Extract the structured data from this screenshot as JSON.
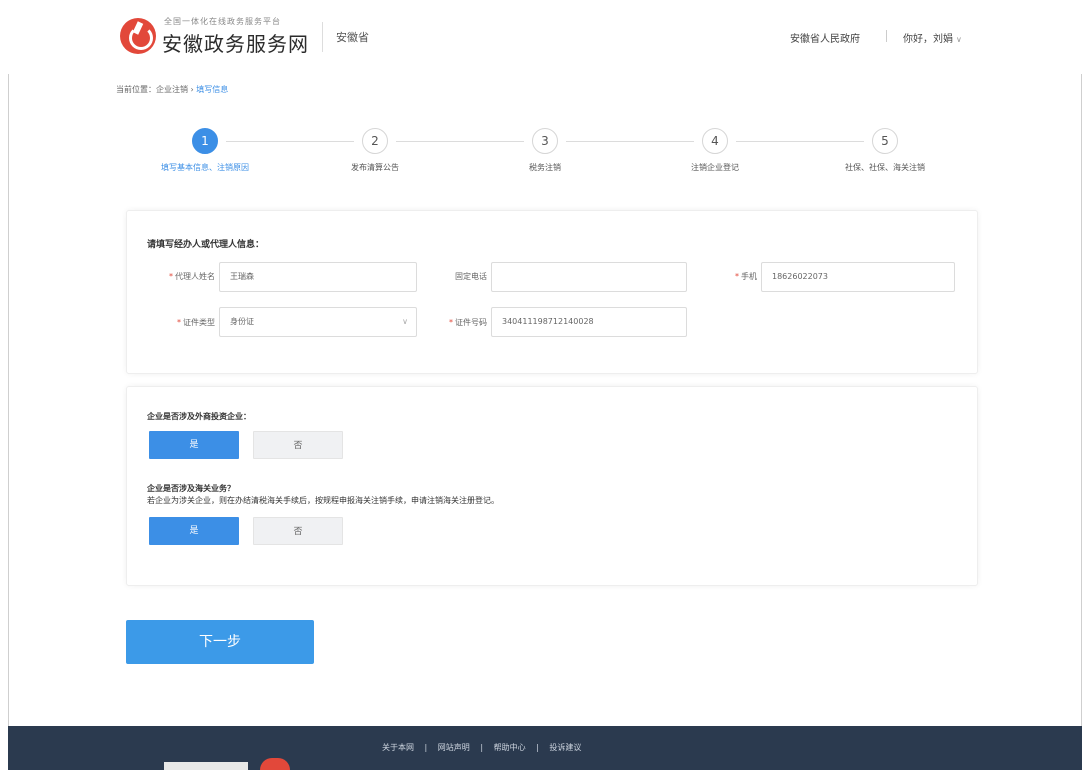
{
  "header": {
    "logo_subtitle": "全国一体化在线政务服务平台",
    "logo_title": "安徽政务服务网",
    "region": "安徽省",
    "gov_link": "安徽省人民政府",
    "user_greeting": "你好，刘娟",
    "chevron_icon": "chevron-down-icon"
  },
  "breadcrumb": {
    "prefix": "当前位置：企业注销 › ",
    "current": "填写信息"
  },
  "stepper": {
    "active_index": 1,
    "steps": [
      {
        "num": "1",
        "label": "填写基本信息、注销原因"
      },
      {
        "num": "2",
        "label": "发布清算公告"
      },
      {
        "num": "3",
        "label": "税务注销"
      },
      {
        "num": "4",
        "label": "注销企业登记"
      },
      {
        "num": "5",
        "label": "社保、社保、海关注销"
      }
    ]
  },
  "agent_form": {
    "title": "请填写经办人或代理人信息：",
    "fields": {
      "name": {
        "label": "代理人姓名",
        "required": true,
        "value": "王瑞森"
      },
      "landline": {
        "label": "固定电话",
        "required": false,
        "value": ""
      },
      "mobile": {
        "label": "手机",
        "required": true,
        "value": "18626022073"
      },
      "id_type": {
        "label": "证件类型",
        "required": true,
        "value": "身份证"
      },
      "id_number": {
        "label": "证件号码",
        "required": true,
        "value": "340411198712140028"
      }
    }
  },
  "questions": {
    "q1": {
      "title": "企业是否涉及外商投资企业：",
      "yes_label": "是",
      "no_label": "否",
      "selected": "yes"
    },
    "q2": {
      "title": "企业是否涉及海关业务？",
      "desc": "若企业为涉关企业，则在办结清税海关手续后，按规程申报海关注销手续，申请注销海关注册登记。",
      "yes_label": "是",
      "no_label": "否",
      "selected": "yes"
    }
  },
  "next_button": "下一步",
  "footer": {
    "links": [
      "关于本网",
      "网站声明",
      "帮助中心",
      "投诉建议"
    ],
    "separator": "|"
  },
  "colors": {
    "accent": "#3c8fe6",
    "brand_red": "#e2483a",
    "footer_bg": "#2b3a4f"
  }
}
